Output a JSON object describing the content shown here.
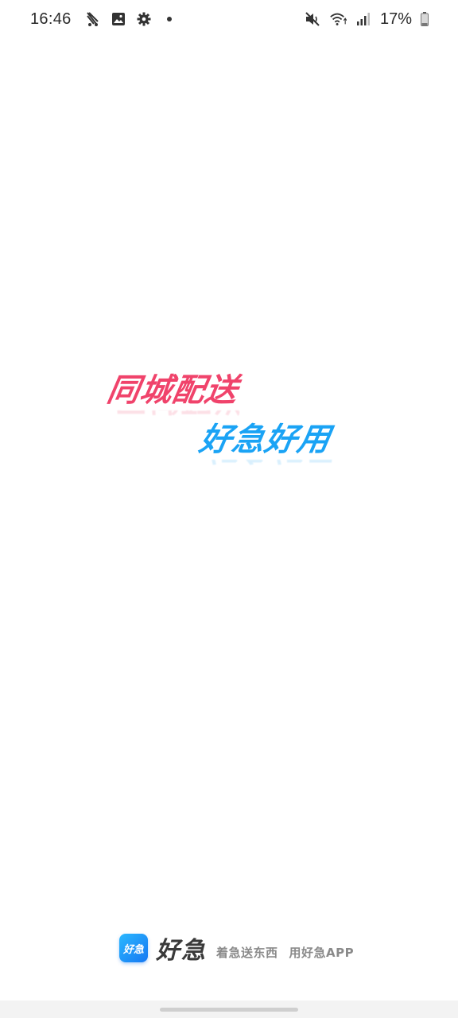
{
  "status_bar": {
    "time": "16:46",
    "left_icons": [
      "delivery-app-icon",
      "image-icon",
      "gear-icon",
      "dot-icon"
    ],
    "right_icons": [
      "mute-icon",
      "wifi-icon",
      "signal-icon",
      "battery-icon"
    ],
    "battery": "17%"
  },
  "splash": {
    "slogan_line1": "同城配送",
    "slogan_line2": "好急好用",
    "colors": {
      "line1": "#f0436b",
      "line2": "#1aa3f5"
    }
  },
  "brand": {
    "logo_text": "好急",
    "name": "好急",
    "tagline_part1": "着急送东西",
    "tagline_part2": "用好急APP",
    "logo_color": "#1a8cf5"
  }
}
